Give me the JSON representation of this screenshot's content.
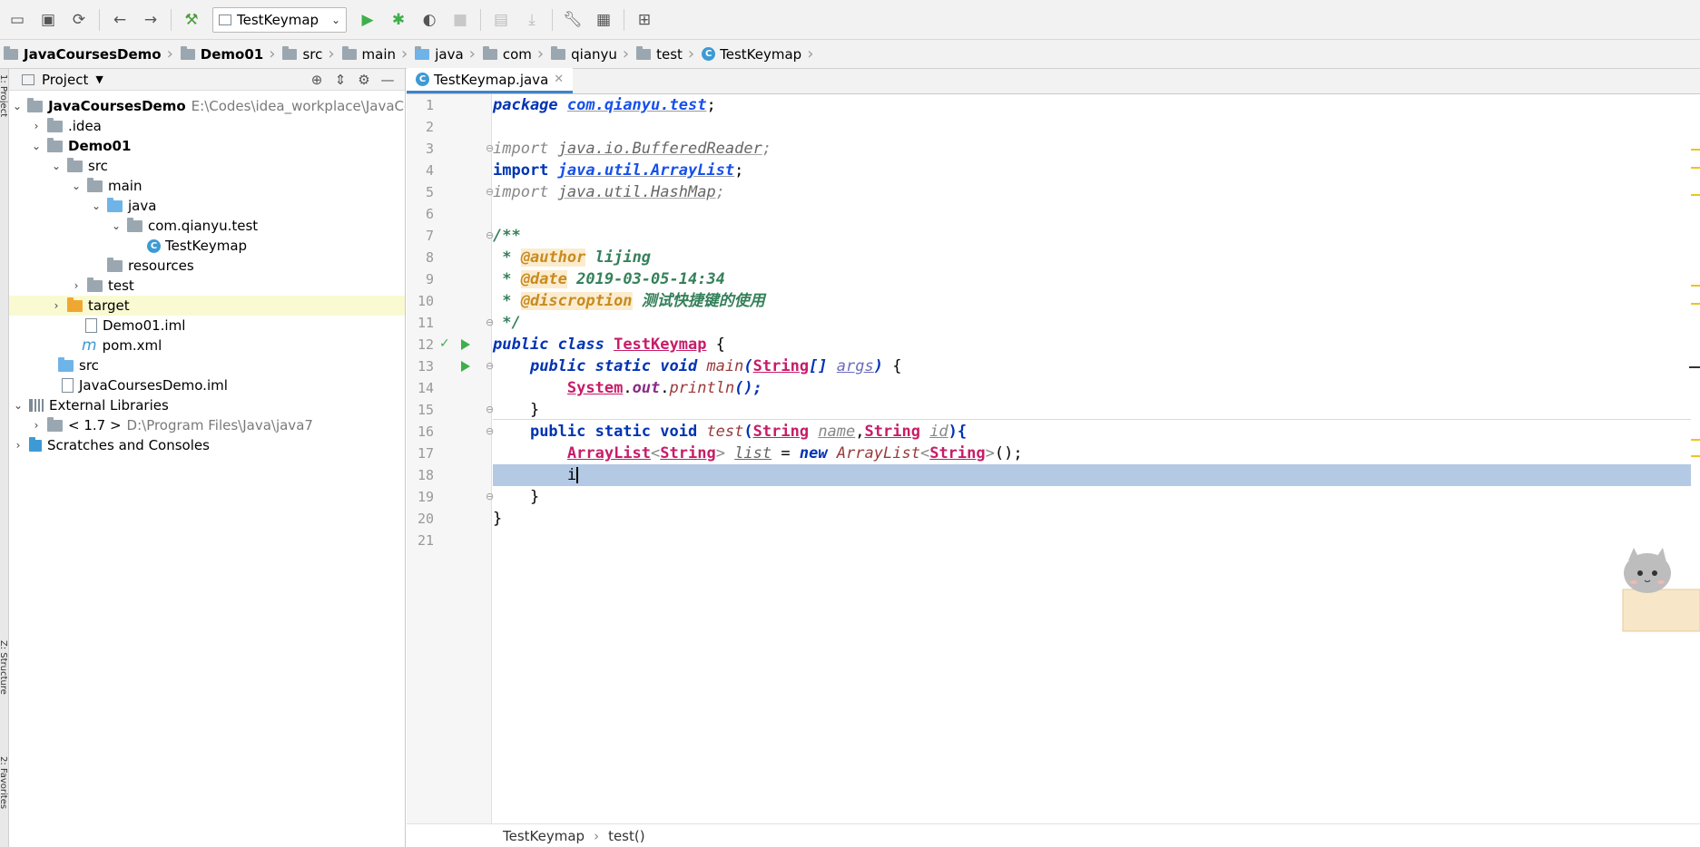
{
  "toolbar": {
    "run_config": "TestKeymap"
  },
  "breadcrumb": [
    {
      "label": "JavaCoursesDemo",
      "bold": true
    },
    {
      "label": "Demo01",
      "bold": true
    },
    {
      "label": "src"
    },
    {
      "label": "main"
    },
    {
      "label": "java"
    },
    {
      "label": "com"
    },
    {
      "label": "qianyu"
    },
    {
      "label": "test"
    },
    {
      "label": "TestKeymap",
      "class_icon": true
    }
  ],
  "sidebar_stripe": {
    "project": "1: Project",
    "structure": "Z: Structure",
    "favorites": "2: Favorites"
  },
  "project_panel": {
    "title": "Project",
    "tree": [
      {
        "label": "JavaCoursesDemo",
        "path": "E:\\Codes\\idea_workplace\\JavaCo",
        "bold": true
      },
      {
        "label": ".idea"
      },
      {
        "label": "Demo01",
        "bold": true
      },
      {
        "label": "src"
      },
      {
        "label": "main"
      },
      {
        "label": "java"
      },
      {
        "label": "com.qianyu.test"
      },
      {
        "label": "TestKeymap"
      },
      {
        "label": "resources"
      },
      {
        "label": "test"
      },
      {
        "label": "target"
      },
      {
        "label": "Demo01.iml"
      },
      {
        "label": "pom.xml"
      },
      {
        "label": "src"
      },
      {
        "label": "JavaCoursesDemo.iml"
      },
      {
        "label": "External Libraries"
      },
      {
        "label": "< 1.7 >",
        "path": "D:\\Program Files\\Java\\java7"
      },
      {
        "label": "Scratches and Consoles"
      }
    ]
  },
  "editor": {
    "tab_label": "TestKeymap.java",
    "line_numbers": [
      "1",
      "2",
      "3",
      "4",
      "5",
      "6",
      "7",
      "8",
      "9",
      "10",
      "11",
      "12",
      "13",
      "14",
      "15",
      "16",
      "17",
      "18",
      "19",
      "20",
      "21"
    ],
    "code": {
      "l1_kw": "package",
      "l1_pkg": "com.qianyu.test",
      "l3_kw": "import",
      "l3_pkg": "java.io.BufferedReader",
      "l4_kw": "import",
      "l4_pkg": "java.util.ArrayList",
      "l5_kw": "import",
      "l5_pkg": "java.util.HashMap",
      "l7": "/**",
      "l8_tag": "@author",
      "l8_text": "lijing",
      "l9_tag": "@date",
      "l9_text": "2019-03-05-14:34",
      "l10_tag": "@discroption",
      "l10_text": "测试快捷键的使用",
      "l11": "*/",
      "l12_kw": "public class",
      "l12_cls": "TestKeymap",
      "l13_kw": "public static void",
      "l13_meth": "main",
      "l13_type": "String",
      "l13_par": "args",
      "l14_cls": "System",
      "l14_fld": "out",
      "l14_meth": "println",
      "l16_kw": "public static void",
      "l16_meth": "test",
      "l16_type1": "String",
      "l16_par1": "name",
      "l16_type2": "String",
      "l16_par2": "id",
      "l17_cls": "ArrayList",
      "l17_type": "String",
      "l17_var": "list",
      "l17_kw": "new",
      "l17_cls2": "ArrayList",
      "l17_type2": "String",
      "l18_text": "i"
    }
  },
  "status_crumbs": [
    "TestKeymap",
    "test()"
  ]
}
